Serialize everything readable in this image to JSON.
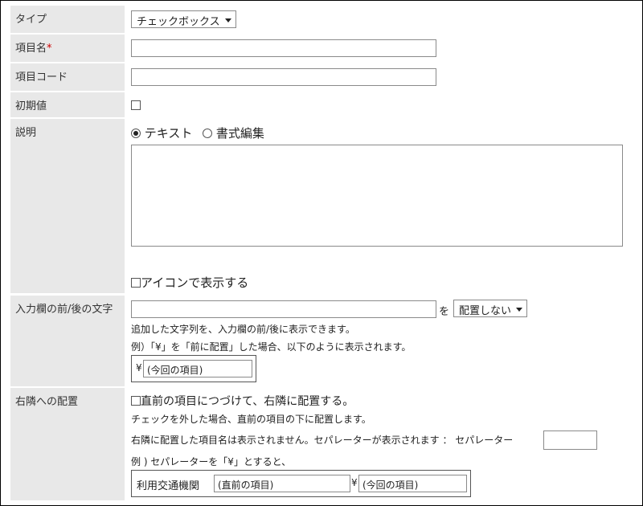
{
  "rows": {
    "type": {
      "label": "タイプ",
      "selected": "チェックボックス"
    },
    "item_name": {
      "label": "項目名",
      "required_mark": "*",
      "value": ""
    },
    "item_code": {
      "label": "項目コード",
      "value": ""
    },
    "default_value": {
      "label": "初期値",
      "checked": false
    },
    "description": {
      "label": "説明",
      "options": [
        "テキスト",
        "書式編集"
      ],
      "selected_option": "テキスト",
      "text": "",
      "show_icon_label": "アイコンで表示する"
    },
    "affix": {
      "label": "入力欄の前/後の文字",
      "value": "",
      "particle": "を",
      "position_selected": "配置しない",
      "help1": "追加した文字列を、入力欄の前/後に表示できます。",
      "help2": "例）「¥」を「前に配置」した場合、以下のように表示されます。",
      "example_prefix": "¥",
      "example_field": "(今回の項目)"
    },
    "right_layout": {
      "label": "右隣への配置",
      "checkbox_label": "直前の項目につづけて、右隣に配置する。",
      "help1": "チェックを外した場合、直前の項目の下に配置します。",
      "help2": "右隣に配置した項目名は表示されません。セパレーターが表示されます ： セパレーター",
      "separator_value": "",
      "help3": "例 ) セパレーターを「¥」とすると、",
      "example_label": "利用交通機関",
      "example_prev_field": "(直前の項目)",
      "example_separator": "¥",
      "example_current_field": "(今回の項目)"
    }
  }
}
